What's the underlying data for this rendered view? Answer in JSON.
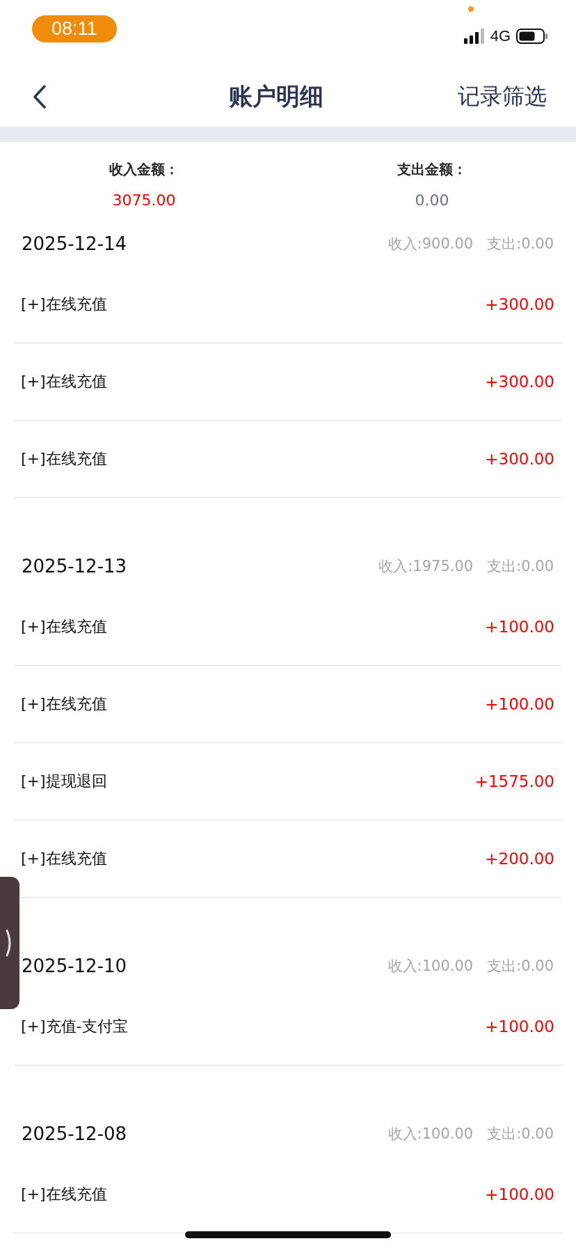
{
  "status_bar": {
    "time": "08:11",
    "network": "4G"
  },
  "nav": {
    "title": "账户明细",
    "action": "记录筛选"
  },
  "summary": [
    {
      "label": "收入金额：",
      "value": "3075.00",
      "kind": "income"
    },
    {
      "label": "支出金额：",
      "value": "0.00",
      "kind": "expense"
    }
  ],
  "groups": [
    {
      "date": "2025-12-14",
      "income": "收入:900.00",
      "expense": "支出:0.00",
      "entries": [
        {
          "name": "[+]在线充值",
          "amount": "+300.00"
        },
        {
          "name": "[+]在线充值",
          "amount": "+300.00"
        },
        {
          "name": "[+]在线充值",
          "amount": "+300.00"
        }
      ]
    },
    {
      "date": "2025-12-13",
      "income": "收入:1975.00",
      "expense": "支出:0.00",
      "entries": [
        {
          "name": "[+]在线充值",
          "amount": "+100.00"
        },
        {
          "name": "[+]在线充值",
          "amount": "+100.00"
        },
        {
          "name": "[+]提现退回",
          "amount": "+1575.00"
        },
        {
          "name": "[+]在线充值",
          "amount": "+200.00"
        }
      ]
    },
    {
      "date": "2025-12-10",
      "income": "收入:100.00",
      "expense": "支出:0.00",
      "entries": [
        {
          "name": "[+]充值-支付宝",
          "amount": "+100.00"
        }
      ]
    },
    {
      "date": "2025-12-08",
      "income": "收入:100.00",
      "expense": "支出:0.00",
      "entries": [
        {
          "name": "[+]在线充值",
          "amount": "+100.00"
        }
      ]
    }
  ]
}
